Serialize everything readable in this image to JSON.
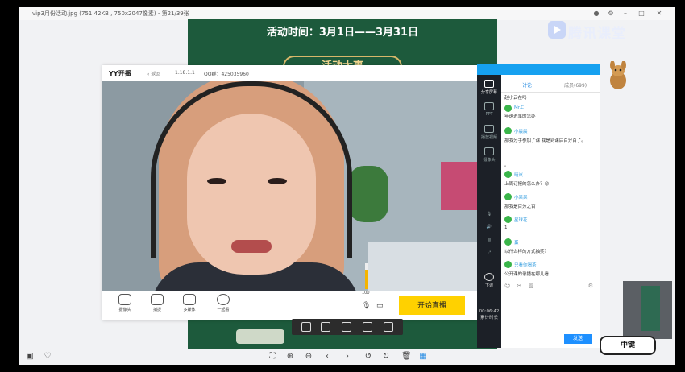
{
  "viewer": {
    "title": "vip3月份活动.jpg (751.42KB , 750x2047像素) - 第21/39张"
  },
  "poster": {
    "time_text": "活动时间：3月1日——3月31日",
    "badge_text": "活动大事"
  },
  "brand": {
    "name": "腾讯课堂"
  },
  "yy": {
    "logo": "YY开播",
    "back": "‹ 返回",
    "version": "1.18.1.1",
    "qq": "QQ群：425035960",
    "controls": [
      "摄像头",
      "捕捉",
      "多媒体",
      "一起看"
    ],
    "volume_label": "100",
    "volume_level": 0.75,
    "start_button": "开始直播"
  },
  "chat": {
    "sidebar": [
      "分享屏幕",
      "PPT",
      "播放视频",
      "摄像头"
    ],
    "timer": "00:06:42",
    "timer_label": "累计时长",
    "sidebar_bottom": "下课",
    "tabs": {
      "discuss": "讨论",
      "members": "成员(699)"
    },
    "messages": [
      {
        "user": "",
        "text": "赵小云在吗"
      },
      {
        "user": "Mr.C",
        "text": "年速进率的怎办"
      },
      {
        "user": "小晨晨",
        "text": "那我分手参加了课 我是到课后百分百了。"
      },
      {
        "user": "",
        "text": "。"
      },
      {
        "user": "晴岚",
        "text": "上周订报的怎么办？😊"
      },
      {
        "user": "小果果",
        "text": "那我是百分之百"
      },
      {
        "user": "星球花",
        "text": "1"
      },
      {
        "user": "蛋",
        "text": "以什么样的方式抽奖？"
      },
      {
        "user": "只看你喝茶",
        "text": "公开课的录播在哪儿看"
      }
    ],
    "send_button": "发送"
  },
  "stamp": {
    "text": "中键"
  },
  "colors": {
    "poster_green": "#1d5a3c",
    "start_yellow": "#ffd100",
    "chat_blue": "#16a1f0",
    "sidebar_dark": "#1c2027"
  }
}
